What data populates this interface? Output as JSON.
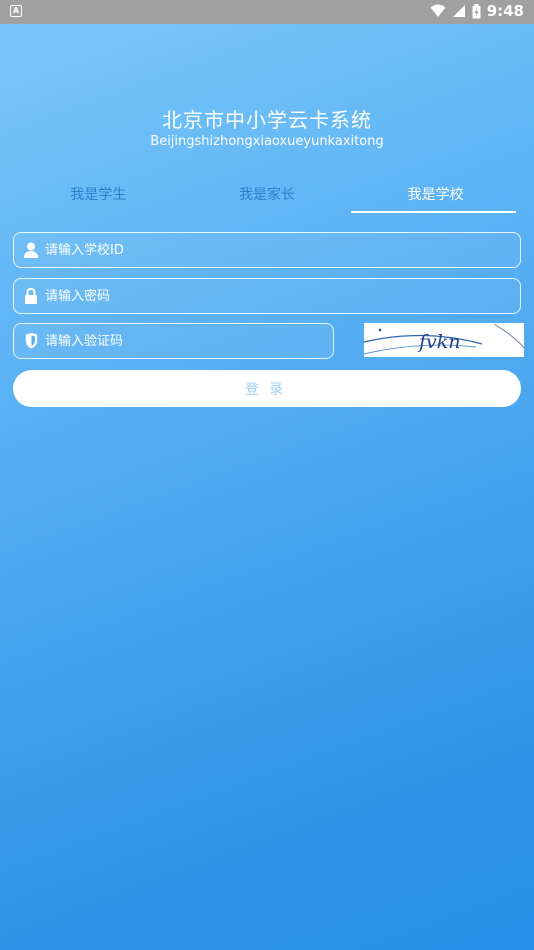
{
  "status_bar": {
    "notification_glyph": "A",
    "time": "9:48"
  },
  "header": {
    "title": "北京市中小学云卡系统",
    "subtitle": "Beijingshizhongxiaoxueyunkaxitong"
  },
  "tabs": [
    {
      "label": "我是学生",
      "active": false
    },
    {
      "label": "我是家长",
      "active": false
    },
    {
      "label": "我是学校",
      "active": true
    }
  ],
  "form": {
    "school_id": {
      "placeholder": "请输入学校ID",
      "value": "",
      "icon": "user-icon"
    },
    "password": {
      "placeholder": "请输入密码",
      "value": "",
      "icon": "lock-icon"
    },
    "captcha": {
      "placeholder": "请输入验证码",
      "value": "",
      "icon": "shield-icon",
      "image_text": "fvkn"
    }
  },
  "login_label": "登录",
  "colors": {
    "bg_top": "#7cc8fb",
    "bg_bottom": "#2590e6",
    "tab_inactive": "#2d7fc6",
    "button_text": "#9fd0f5"
  }
}
